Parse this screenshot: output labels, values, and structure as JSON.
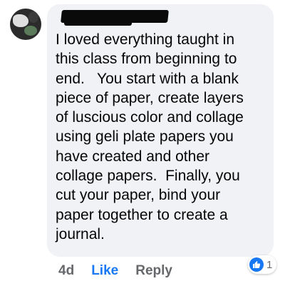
{
  "comment": {
    "text": "I loved everything taught in\nthis class from beginning to\nend.   You start with a blank\npiece of paper, create layers\nof luscious color and collage\nusing geli plate papers you\nhave created and other\ncollage papers.  Finally, you\ncut your paper, bind your\npaper together to create a\njournal."
  },
  "actions": {
    "time": "4d",
    "like_label": "Like",
    "reply_label": "Reply"
  },
  "reactions": {
    "icon": "thumbs-up-icon",
    "count": "1",
    "color": "#1877f2"
  },
  "colors": {
    "bubble": "#f0f2f5",
    "text": "#050505",
    "muted": "#65676b",
    "link": "#1877f2"
  }
}
